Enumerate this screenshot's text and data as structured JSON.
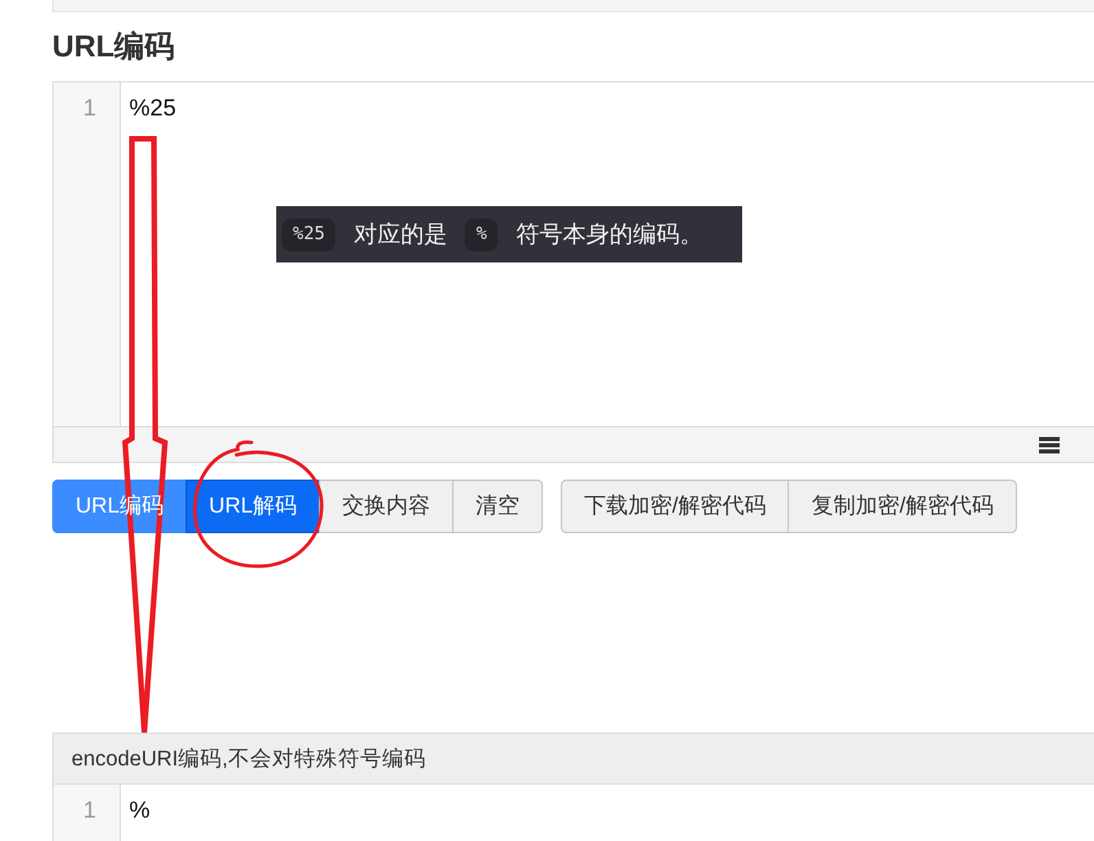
{
  "heading": "URL编码",
  "input_editor": {
    "lines": [
      {
        "number": "1",
        "text": "%25"
      }
    ]
  },
  "note": {
    "parts": [
      {
        "kind": "code",
        "text": "%25"
      },
      {
        "kind": "text",
        "text": "对应的是"
      },
      {
        "kind": "code",
        "text": "%"
      },
      {
        "kind": "text",
        "text": "符号本身的编码。"
      }
    ]
  },
  "button_groups": [
    {
      "buttons": [
        {
          "label": "URL编码",
          "kind": "primary",
          "active": false
        },
        {
          "label": "URL解码",
          "kind": "primary",
          "active": true
        },
        {
          "label": "交换内容",
          "kind": "default",
          "active": false
        },
        {
          "label": "清空",
          "kind": "default",
          "active": false
        }
      ]
    },
    {
      "buttons": [
        {
          "label": "下载加密/解密代码",
          "kind": "default",
          "active": false
        },
        {
          "label": "复制加密/解密代码",
          "kind": "default",
          "active": false
        }
      ]
    }
  ],
  "result_panel": {
    "title": "encodeURI编码,不会对特殊符号编码",
    "lines": [
      {
        "number": "1",
        "text": "%"
      }
    ]
  }
}
